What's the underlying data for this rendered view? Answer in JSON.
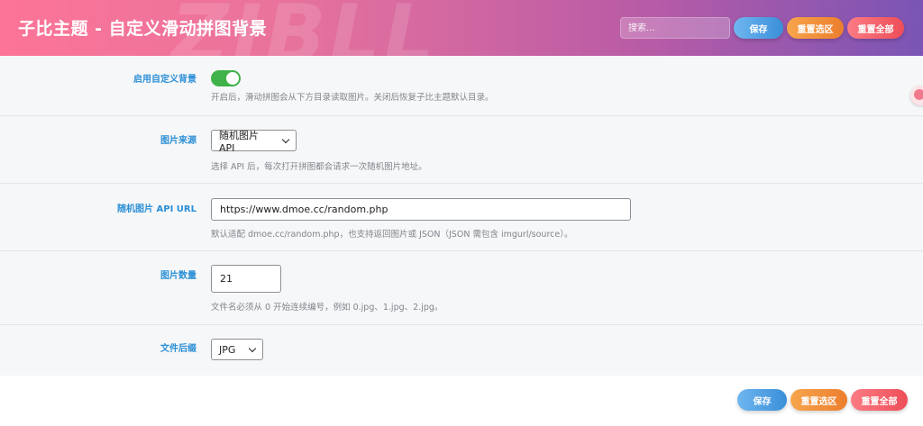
{
  "header": {
    "title": "子比主题 - 自定义滑动拼图背景",
    "watermark": "ZIBLL",
    "search_placeholder": "搜索...",
    "save_label": "保存",
    "reset_section_label": "重置选区",
    "reset_all_label": "重置全部"
  },
  "fields": {
    "enable": {
      "label": "启用自定义背景",
      "enabled": true,
      "desc": "开启后，滑动拼图会从下方目录读取图片。关闭后恢复子比主题默认目录。"
    },
    "source": {
      "label": "图片来源",
      "value": "随机图片 API",
      "desc": "选择 API 后，每次打开拼图都会请求一次随机图片地址。"
    },
    "api_url": {
      "label": "随机图片 API URL",
      "value": "https://www.dmoe.cc/random.php",
      "desc": "默认适配 dmoe.cc/random.php，也支持返回图片或 JSON（JSON 需包含 imgurl/source）。"
    },
    "count": {
      "label": "图片数量",
      "value": "21",
      "desc": "文件名必须从 0 开始连续编号，例如 0.jpg、1.jpg、2.jpg。"
    },
    "ext": {
      "label": "文件后缀",
      "value": "JPG"
    }
  },
  "footer": {
    "save_label": "保存",
    "reset_section_label": "重置选区",
    "reset_all_label": "重置全部"
  },
  "colors": {
    "header_start": "#fc7497",
    "header_end": "#7a55b5",
    "label_blue": "#2b8fd6",
    "toggle_green": "#3fb24a"
  },
  "icons": {
    "side_tab": "sidebar-float-icon",
    "select_arrow": "chevron-down-icon"
  }
}
